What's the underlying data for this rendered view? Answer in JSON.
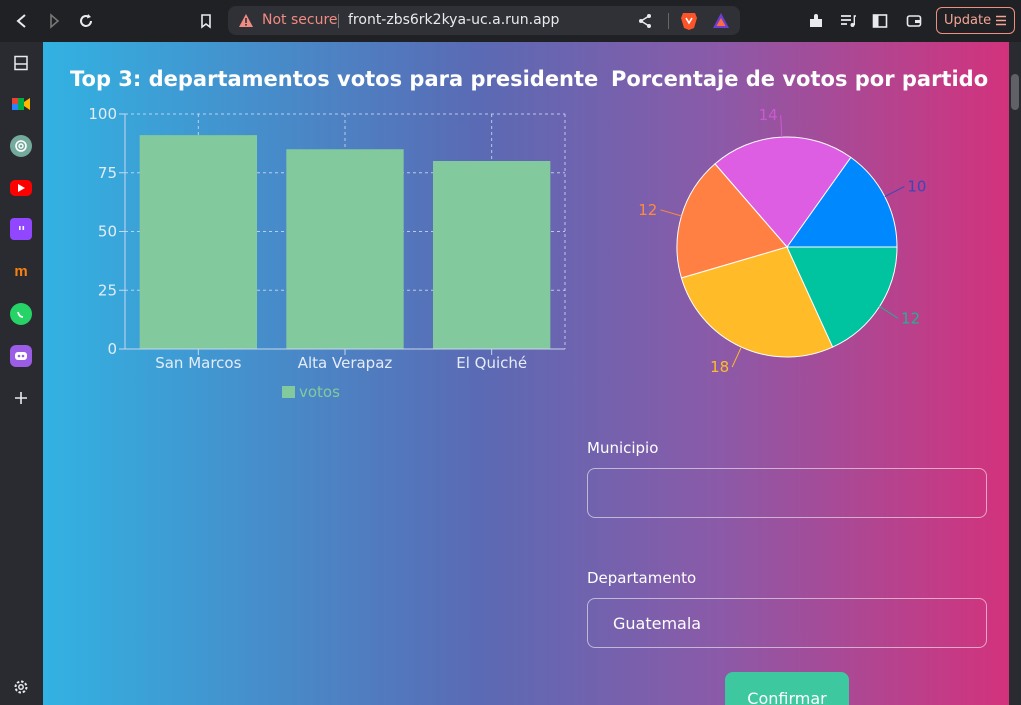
{
  "browser": {
    "security_label": "Not secure",
    "url": "front-zbs6rk2kya-uc.a.run.app",
    "update_label": "Update"
  },
  "sidebar": {
    "items": [
      "notes-icon",
      "google-meet-icon",
      "chatgpt-icon",
      "youtube-icon",
      "twitch-icon",
      "moodle-icon",
      "whatsapp-icon",
      "discord-bot-icon",
      "add-icon",
      "settings-icon"
    ]
  },
  "bar_section": {
    "title": "Top 3: departamentos votos para presidente"
  },
  "pie_section": {
    "title": "Porcentaje de votos por partido"
  },
  "form": {
    "municipio_label": "Municipio",
    "municipio_value": "",
    "departamento_label": "Departamento",
    "departamento_value": "Guatemala",
    "confirm_label": "Confirmar"
  },
  "colors": {
    "bar": "#82ca9d",
    "pie": [
      "#0088fe",
      "#dd5ee3",
      "#ff8042",
      "#ffbb28",
      "#00c49f"
    ],
    "pie_labels": [
      "#3a47b8",
      "#c95bd0",
      "#ff8a3c",
      "#ffbb28",
      "#1fb393"
    ]
  },
  "chart_data": [
    {
      "type": "bar",
      "categories": [
        "San Marcos",
        "Alta Verapaz",
        "El Quiché"
      ],
      "series": [
        {
          "name": "votos",
          "values": [
            91,
            85,
            80
          ]
        }
      ],
      "title": "Top 3: departamentos votos para presidente",
      "ylim": [
        0,
        100
      ],
      "yticks": [
        0,
        25,
        50,
        75,
        100
      ],
      "grid": true,
      "legend": "bottom"
    },
    {
      "type": "pie",
      "values": [
        10,
        14,
        12,
        18,
        12
      ],
      "title": "Porcentaje de votos por partido"
    }
  ]
}
